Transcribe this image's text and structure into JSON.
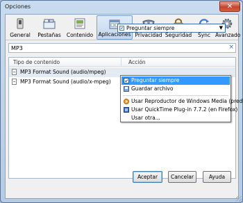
{
  "window": {
    "title": "Opciones",
    "close_label": "✕"
  },
  "toolbar": [
    {
      "label": "General",
      "icon": "switch-icon"
    },
    {
      "label": "Pestañas",
      "icon": "tabs-icon"
    },
    {
      "label": "Contenido",
      "icon": "content-icon"
    },
    {
      "label": "Aplicaciones",
      "icon": "applications-icon"
    },
    {
      "label": "Privacidad",
      "icon": "mask-icon"
    },
    {
      "label": "Seguridad",
      "icon": "lock-icon"
    },
    {
      "label": "Sync",
      "icon": "sync-icon"
    },
    {
      "label": "Avanzado",
      "icon": "gear-icon"
    }
  ],
  "search": {
    "value": "MP3",
    "clear_icon": "×"
  },
  "table": {
    "columns": [
      "Tipo de contenido",
      "Acción"
    ],
    "rows": [
      {
        "type": "MP3 Format Sound (audio/mpeg)",
        "action": "Preguntar siempre"
      },
      {
        "type": "MP3 Format Sound (audio/x-mpeg)",
        "action": ""
      }
    ]
  },
  "combo": {
    "selected": "Preguntar siempre",
    "arrow": "▼"
  },
  "dropdown": {
    "options": [
      "Preguntar siempre",
      "Guardar archivo",
      "Usar Reproductor de Windows Media (pred...",
      "Usar QuickTime Plug-in 7.7.2 (en Firefox)",
      "Usar otra..."
    ]
  },
  "buttons": {
    "accept": "Aceptar",
    "cancel": "Cancelar",
    "help": "Ayuda"
  },
  "colors": {
    "selection": "#3399ff",
    "accent": "#3c7fb1"
  }
}
